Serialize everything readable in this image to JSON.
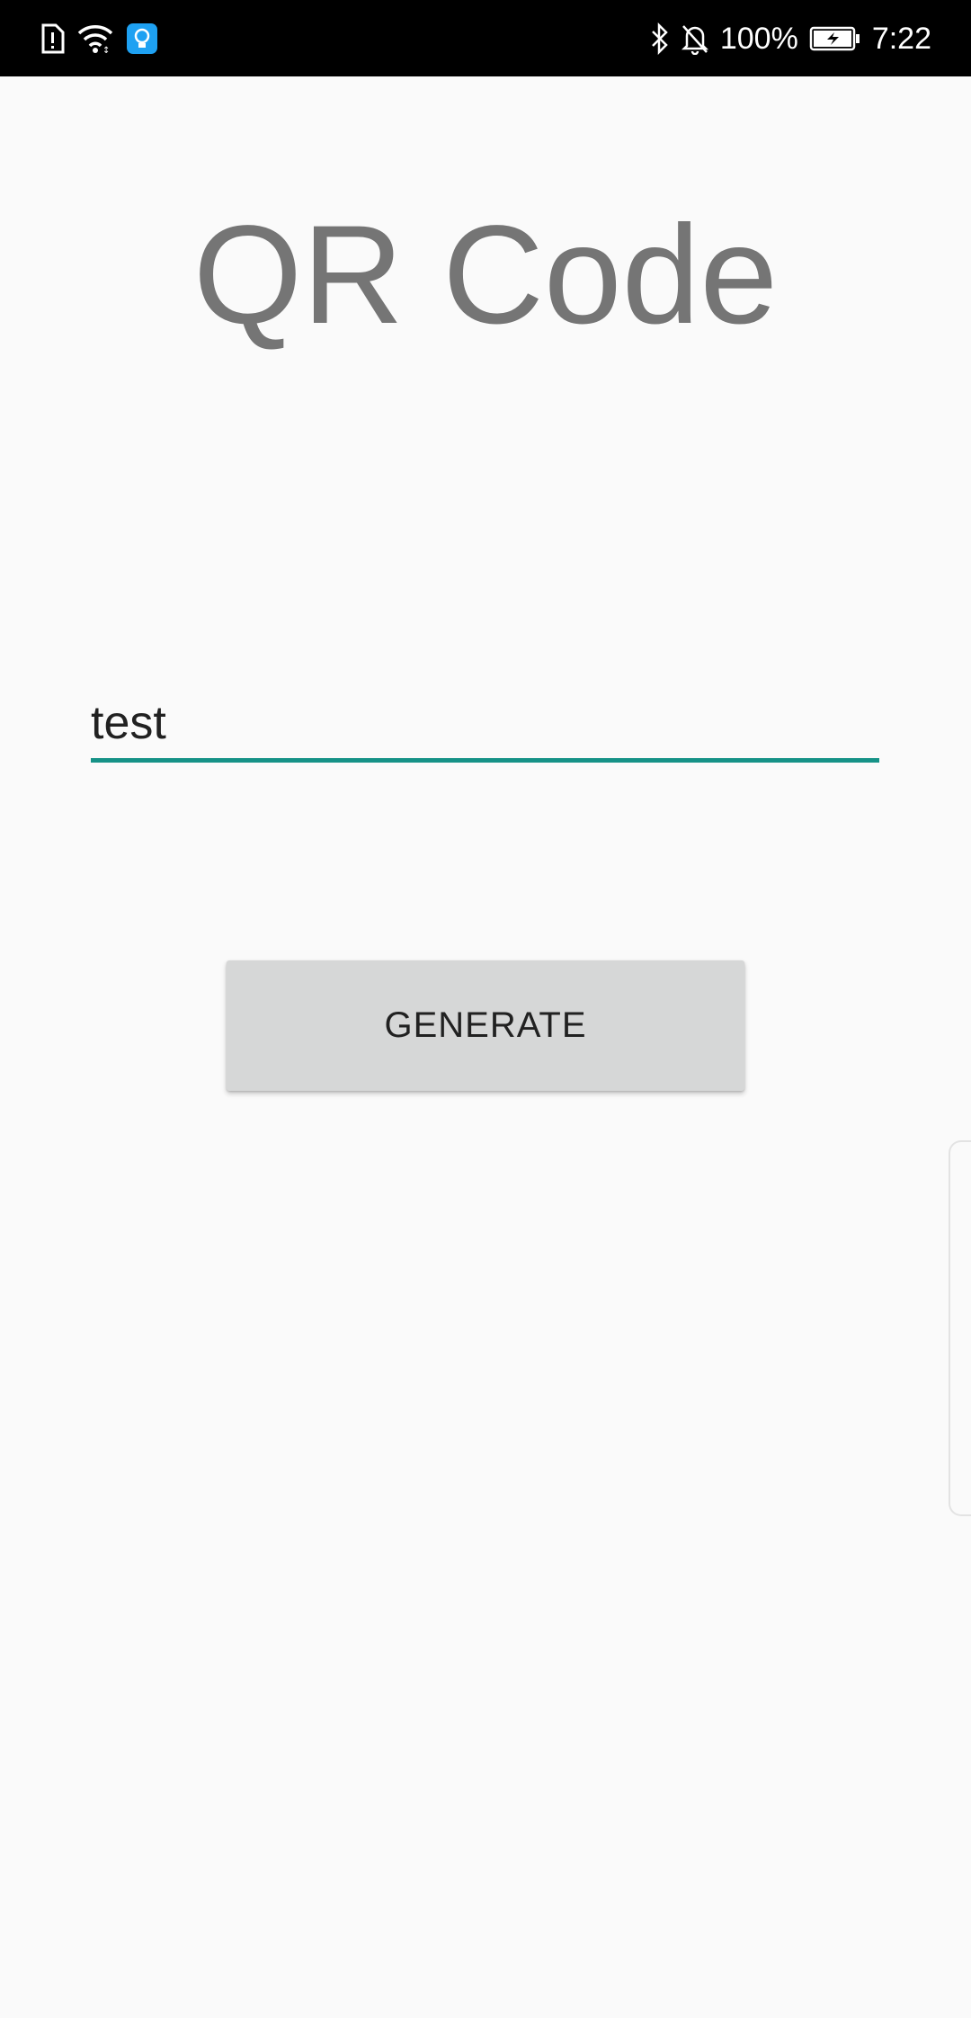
{
  "status_bar": {
    "battery_percent": "100%",
    "time": "7:22",
    "icons": [
      "sim-alert-icon",
      "wifi-icon",
      "app-notification-icon",
      "bluetooth-icon",
      "mute-bell-icon",
      "battery-charging-icon"
    ]
  },
  "title": "QR Code",
  "input": {
    "value": "test",
    "accent_color": "#169287"
  },
  "generate_button": {
    "label": "GENERATE"
  },
  "colors": {
    "background": "#fafafa",
    "title": "#757575",
    "button": "#d6d7d7"
  }
}
